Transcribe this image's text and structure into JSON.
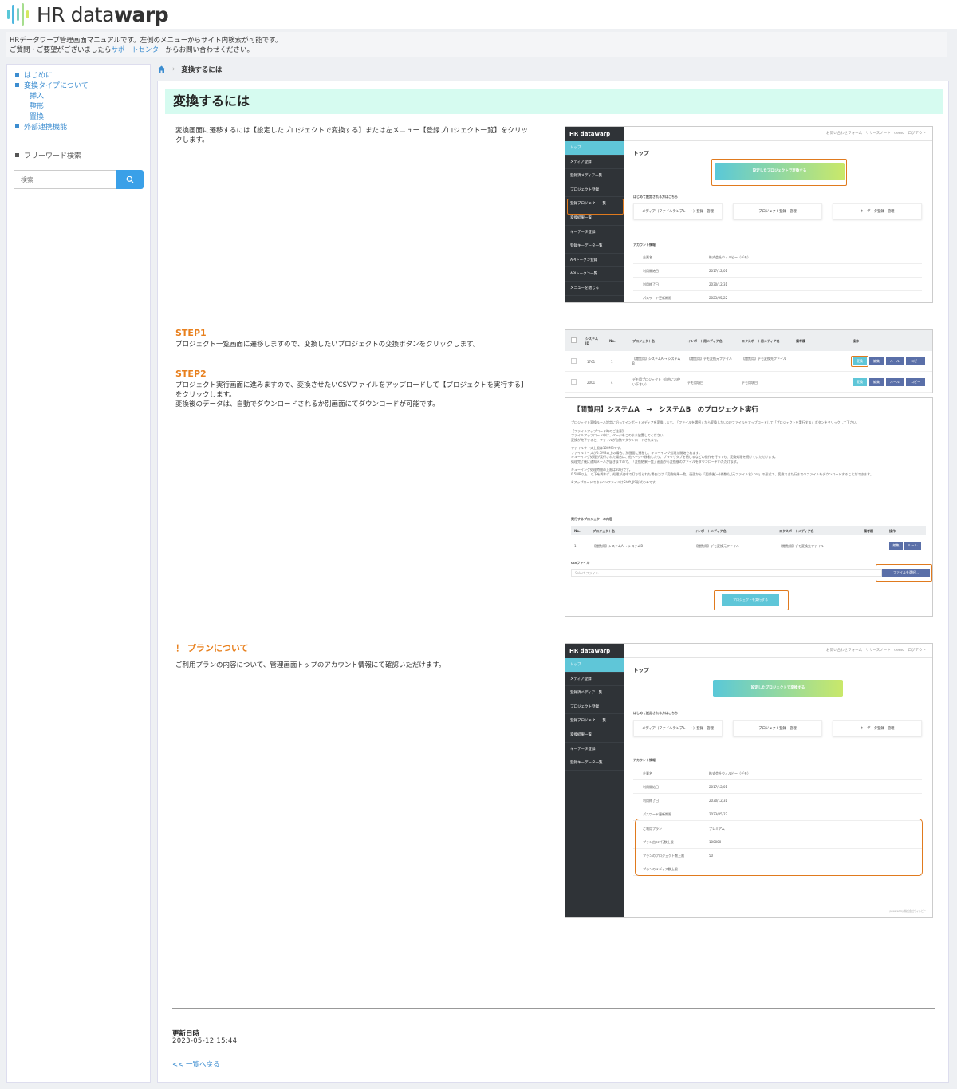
{
  "brand": {
    "logo_text_light": "HR data",
    "logo_text_bold": "warp",
    "accent": "#3c8dd0",
    "highlight": "#e07a1e",
    "title_bg": "#d6fbf0"
  },
  "intro": {
    "line1": "HRデータワープ管理画面マニュアルです。左側のメニューからサイト内検索が可能です。",
    "line2_pre": "ご質問・ご要望がございましたら",
    "line2_link": "サポートセンター",
    "line2_post": "からお問い合わせください。"
  },
  "sidebar": {
    "items": [
      {
        "label": "はじめに"
      },
      {
        "label": "変換タイプについて"
      },
      {
        "label": "挿入"
      },
      {
        "label": "整形"
      },
      {
        "label": "置換"
      },
      {
        "label": "外部連携機能"
      }
    ],
    "freeword_label": "フリーワード検索",
    "search_placeholder": "検索"
  },
  "breadcrumb": {
    "home_icon": "home-icon",
    "current": "変換するには"
  },
  "page": {
    "title": "変換するには",
    "intro_text_1": "変換画面に遷移するには【設定したプロジェクトで変換する】または左メニュー【登録プロジェクト一覧】をクリッ",
    "intro_text_2": "クします。",
    "step1_title": "STEP1",
    "step1_text": "プロジェクト一覧画面に遷移しますので、変換したいプロジェクトの変換ボタンをクリックします。",
    "step2_title": "STEP2",
    "step2_text_1": "プロジェクト実行画面に進みますので、変換させたいCSVファイルをアップロードして【プロジェクトを実行する】",
    "step2_text_2": "をクリックします。",
    "step2_text_3": "変換後のデータは、自動でダウンロードされるか別画面にてダウンロードが可能です。",
    "plan_title": "！ プランについて",
    "plan_text": "ご利用プランの内容について、管理画面トップのアカウント情報にて確認いただけます。",
    "updated_label": "更新日時",
    "updated_value": "2023-05-12 15:44",
    "back_link": "<< 一覧へ戻る"
  },
  "screens": {
    "app_logo": "HR datawarp",
    "top_links": "お問い合わせフォーム　リリースノート　demo　ログアウト",
    "menu": [
      "トップ",
      "メディア登録",
      "登録済メディア一覧",
      "プロジェクト登録",
      "登録プロジェクト一覧",
      "変換結果一覧",
      "キーデータ登録",
      "登録キーデータ一覧",
      "APIトークン登録",
      "APIトークン一覧",
      "メニューを閉じる"
    ],
    "menu_short": [
      "トップ",
      "メディア登録",
      "登録済メディア一覧",
      "プロジェクト登録",
      "登録プロジェクト一覧",
      "変換結果一覧",
      "キーデータ登録",
      "登録キーデータ一覧"
    ],
    "top_heading": "トップ",
    "big_button": "設定したプロジェクトで変換する",
    "first_time": "はじめて設定される方はこちら",
    "cards": [
      "メディア（ファイルテンプレート）登録・管理",
      "プロジェクト登録・管理",
      "キーデータ登録・管理"
    ],
    "account_heading": "アカウント情報",
    "account_rows": [
      {
        "k": "企業名",
        "v": "株式会社ウィルビー（デモ）"
      },
      {
        "k": "利用開始日",
        "v": "2017/12/01"
      },
      {
        "k": "利用終了日",
        "v": "2030/12/31"
      },
      {
        "k": "パスワード更新期限",
        "v": "2023/05/22"
      }
    ],
    "plan_rows": [
      {
        "k": "ご利用プラン",
        "v": "プレミアム"
      },
      {
        "k": "プラン由csv行数上限",
        "v": "100000"
      },
      {
        "k": "プランのプロジェクト数上限",
        "v": "50"
      },
      {
        "k": "プランのメディア数上限",
        "v": ""
      }
    ],
    "list_headers": [
      "システムID",
      "No.",
      "プロジェクト名",
      "インポート用メディア名",
      "エクスポート用メディア名",
      "備考欄",
      "操作"
    ],
    "list_rows": [
      {
        "id": "1761",
        "no": "1",
        "name": "【閲覧用】システムA → システムB",
        "imp": "【閲覧用】デモ変換元ファイル",
        "exp": "【閲覧用】デモ変換先ファイル"
      },
      {
        "id": "2001",
        "no": "4",
        "name": "デモ用プロジェクト（自由にお使い下さい）",
        "imp": "デモ用項目",
        "exp": "デモ用項目"
      }
    ],
    "list_buttons": [
      "変換",
      "編集",
      "ルール",
      "コピー"
    ],
    "exec_title": "【閲覧用】システムA　→　システムB　のプロジェクト実行",
    "exec_desc": "プロジェクト変換ルール設定に沿ってインポートメディアを変換します。「ファイルを選択」から変換したいcsvファイルをアップロードして「プロジェクトを実行する」ボタンをクリックして下さい。",
    "exec_note_head": "【ファイルアップロード時のご注意】",
    "exec_notes": [
      "ファイルアップロード中は、ページをこのまま放置してください。",
      "変換が完了すると、ファイルが自動でダウンロードされます。",
      "ファイルサイズ上限は100MBです。",
      "ファイルサイズが0.5MB以上の場合、別画面に遷移し、キューイング処理が開始されます。",
      "キューイング処理が実行された場合は、他ページへ移動したり、ブラウザタブを閉じるなどの操作を行っても、変換処理を続けていただけます。",
      "処理完了後に通知メールが届きますので、「変換結果一覧」画面から変換後のファイルをダウンロードいただけます。",
      "キューイング処理時間の上限は20分です。",
      "0.5MB以上・以下を問わず、処理が途中で打ち切られた場合には「変換結果一覧」画面から「変換後(一(件数))_(元ファイル名).csv」の形式で、変換できた行までのファイルをダウンロードすることができます。",
      "※アップロードできるcsvファイルはShift_JIS形式のみです。"
    ],
    "exec_subhead": "実行するプロジェクトの内容",
    "exec_headers": [
      "No.",
      "プロジェクト名",
      "インポートメディア名",
      "エクスポートメディア名",
      "備考欄",
      "操作"
    ],
    "exec_row": [
      "1",
      "【閲覧用】システムA → システムB",
      "【閲覧用】デモ変換元ファイル",
      "【閲覧用】デモ変換先ファイル"
    ],
    "exec_row_buttons": [
      "編集",
      "ルール"
    ],
    "csv_label": "csvファイル",
    "csv_placeholder": "Select ファイル...",
    "file_button": "ファイルを選択…",
    "run_button": "プロジェクトを実行する",
    "footer_small": "powered by 株式会社ウィルビー"
  }
}
